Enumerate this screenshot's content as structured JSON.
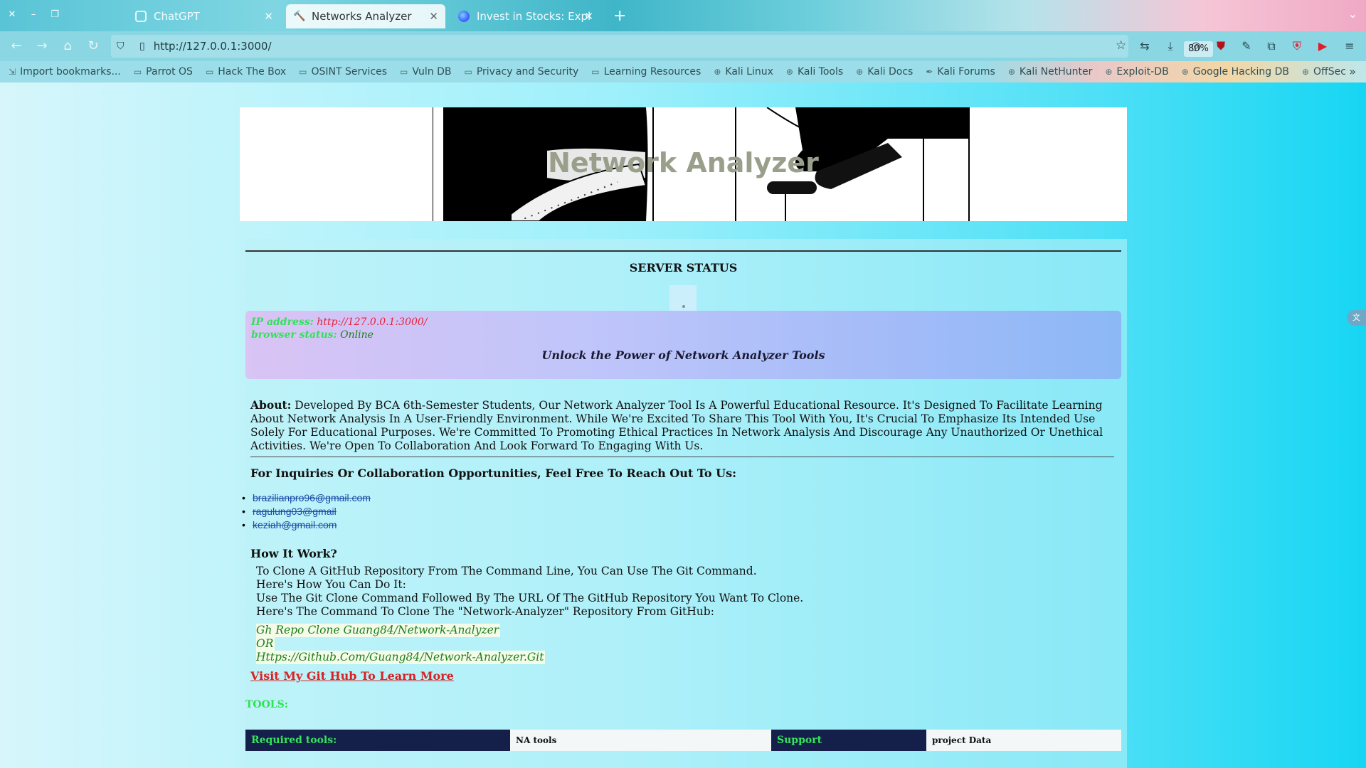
{
  "browser": {
    "tabs": [
      {
        "label": "ChatGPT",
        "active": false
      },
      {
        "label": "Networks Analyzer",
        "active": true
      },
      {
        "label": "Invest in Stocks: Explore",
        "active": false
      }
    ],
    "url": "http://127.0.0.1:3000/",
    "zoom": "80%",
    "bookmarks": [
      "Import bookmarks...",
      "Parrot OS",
      "Hack The Box",
      "OSINT Services",
      "Vuln DB",
      "Privacy and Security",
      "Learning Resources",
      "Kali Linux",
      "Kali Tools",
      "Kali Docs",
      "Kali Forums",
      "Kali NetHunter",
      "Exploit-DB",
      "Google Hacking DB",
      "OffSec"
    ]
  },
  "page": {
    "banner_title": "Network Analyzer",
    "server_status": "SERVER STATUS",
    "info": {
      "ip_label": "IP address:",
      "ip_value": "http://127.0.0.1:3000/",
      "browser_label": "browser status:",
      "browser_value": "Online",
      "tagline": "Unlock the Power of Network Analyzer Tools"
    },
    "about": {
      "label": "About:",
      "text": "Developed By BCA 6th-Semester Students, Our Network Analyzer Tool Is A Powerful Educational Resource. It's Designed To Facilitate Learning About Network Analysis In A User-Friendly Environment. While We're Excited To Share This Tool With You, It's Crucial To Emphasize Its Intended Use Solely For Educational Purposes. We're Committed To Promoting Ethical Practices In Network Analysis And Discourage Any Unauthorized Or Unethical Activities. We're Open To Collaboration And Look Forward To Engaging With Us."
    },
    "inquiries_heading": "For Inquiries Or Collaboration Opportunities, Feel Free To Reach Out To Us:",
    "emails": [
      "brazilianpro96@gmail.com",
      "ragulung03@gmail",
      "keziah@gmail.com"
    ],
    "how_title": "How It Work?",
    "how_lines": [
      "To Clone A GitHub Repository From The Command Line, You Can Use The Git Command.",
      "Here's How You Can Do It:",
      "Use The Git Clone Command Followed By The URL Of The GitHub Repository You Want To Clone.",
      "Here's The Command To Clone The \"Network-Analyzer\" Repository From GitHub:"
    ],
    "commands": [
      "Gh Repo Clone Guang84/Network-Analyzer",
      "OR",
      "Https://Github.Com/Guang84/Network-Analyzer.Git"
    ],
    "git_link": "Visit My Git Hub To Learn More",
    "tools_label": "TOOLS:",
    "tools_row": {
      "required": "Required tools:",
      "na_tools": "NA tools",
      "support": "Support",
      "project_data": "project Data"
    }
  }
}
